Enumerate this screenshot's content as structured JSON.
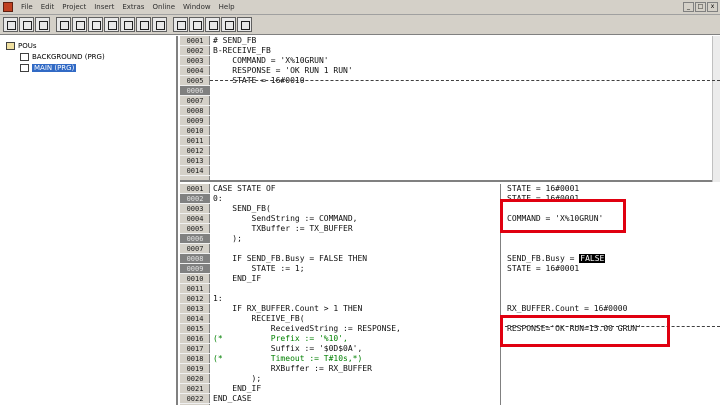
{
  "menubar": {
    "items": [
      "File",
      "Edit",
      "Project",
      "Insert",
      "Extras",
      "Online",
      "Window",
      "Help"
    ]
  },
  "window_controls": [
    "_",
    "□",
    "x"
  ],
  "tree": {
    "root": "POUs",
    "items": [
      "BACKGROUND (PRG)",
      "MAIN (PRG)"
    ],
    "selected_index": 1
  },
  "top_pane": {
    "lines": [
      {
        "num": "0001",
        "text": "# SEND_FB",
        "dark": false
      },
      {
        "num": "0002",
        "text": "B-RECEIVE_FB",
        "dark": false
      },
      {
        "num": "0003",
        "text": "    COMMAND = 'X%10GRUN'",
        "dark": false
      },
      {
        "num": "0004",
        "text": "    RESPONSE = 'OK RUN 1 RUN'",
        "dark": false
      },
      {
        "num": "0005",
        "text": "    STATE = 16#0010",
        "dark": false
      },
      {
        "num": "0006",
        "text": "",
        "dark": true
      },
      {
        "num": "0007",
        "text": "",
        "dark": false
      },
      {
        "num": "0008",
        "text": "",
        "dark": false
      },
      {
        "num": "0009",
        "text": "",
        "dark": false
      },
      {
        "num": "0010",
        "text": "",
        "dark": false
      },
      {
        "num": "0011",
        "text": "",
        "dark": false
      },
      {
        "num": "0012",
        "text": "",
        "dark": false
      },
      {
        "num": "0013",
        "text": "",
        "dark": false
      },
      {
        "num": "0014",
        "text": "",
        "dark": false
      }
    ]
  },
  "bottom_pane": {
    "lines": [
      {
        "num": "0001",
        "text": "CASE STATE OF",
        "dark": false,
        "comment": false
      },
      {
        "num": "0002",
        "text": "0:",
        "dark": true,
        "comment": false
      },
      {
        "num": "0003",
        "text": "    SEND_FB(",
        "dark": false,
        "comment": false
      },
      {
        "num": "0004",
        "text": "        SendString := COMMAND,",
        "dark": false,
        "comment": false
      },
      {
        "num": "0005",
        "text": "        TXBuffer := TX_BUFFER",
        "dark": false,
        "comment": false
      },
      {
        "num": "0006",
        "text": "    );",
        "dark": true,
        "comment": false
      },
      {
        "num": "0007",
        "text": "",
        "dark": false,
        "comment": false
      },
      {
        "num": "0008",
        "text": "    IF SEND_FB.Busy = FALSE THEN",
        "dark": true,
        "comment": false
      },
      {
        "num": "0009",
        "text": "        STATE := 1;",
        "dark": true,
        "comment": false
      },
      {
        "num": "0010",
        "text": "    END_IF",
        "dark": false,
        "comment": false
      },
      {
        "num": "0011",
        "text": "",
        "dark": false,
        "comment": false
      },
      {
        "num": "0012",
        "text": "1:",
        "dark": false,
        "comment": false
      },
      {
        "num": "0013",
        "text": "    IF RX_BUFFER.Count > 1 THEN",
        "dark": false,
        "comment": false
      },
      {
        "num": "0014",
        "text": "        RECEIVE_FB(",
        "dark": false,
        "comment": false
      },
      {
        "num": "0015",
        "text": "            ReceivedString := RESPONSE,",
        "dark": false,
        "comment": false
      },
      {
        "num": "0016",
        "text": "(*          Prefix := '%10',",
        "dark": false,
        "comment": true
      },
      {
        "num": "0017",
        "text": "            Suffix := '$0D$0A',",
        "dark": false,
        "comment": false
      },
      {
        "num": "0018",
        "text": "(*          Timeout := T#10s,*)",
        "dark": false,
        "comment": true
      },
      {
        "num": "0019",
        "text": "            RXBuffer := RX_BUFFER",
        "dark": false,
        "comment": false
      },
      {
        "num": "0020",
        "text": "        );",
        "dark": false,
        "comment": false
      },
      {
        "num": "0021",
        "text": "    END_IF",
        "dark": false,
        "comment": false
      },
      {
        "num": "0022",
        "text": "END_CASE",
        "dark": false,
        "comment": false
      }
    ]
  },
  "monitor": {
    "line_1": "STATE = 16#0001",
    "line_2": "STATE = 16#0001",
    "command_value": "COMMAND = 'X%10GRUN'",
    "busy_label": "SEND_FB.Busy = ",
    "busy_value": "FALSE",
    "state_value": "STATE = 16#0001",
    "count_value": "RX_BUFFER.Count = 16#0000",
    "response_value": "RESPONSE='OK RUN=15.00 GRUN'"
  }
}
